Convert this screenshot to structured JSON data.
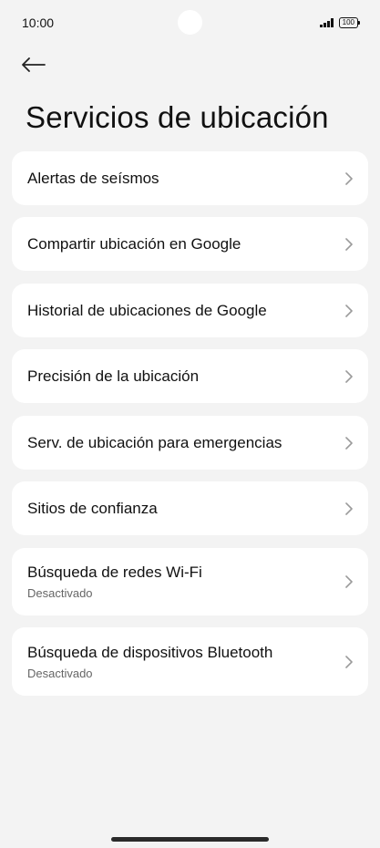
{
  "status_bar": {
    "time": "10:00",
    "battery": "100",
    "icons": [
      "signal-icon",
      "battery-icon"
    ]
  },
  "header": {
    "back_icon": "arrow-left-icon",
    "title": "Servicios de ubicación"
  },
  "items": [
    {
      "label": "Alertas de seísmos",
      "subtitle": ""
    },
    {
      "label": "Compartir ubicación en Google",
      "subtitle": ""
    },
    {
      "label": "Historial de ubicaciones de Google",
      "subtitle": ""
    },
    {
      "label": "Precisión de la ubicación",
      "subtitle": ""
    },
    {
      "label": "Serv. de ubicación para emergencias",
      "subtitle": ""
    },
    {
      "label": "Sitios de confianza",
      "subtitle": ""
    },
    {
      "label": "Búsqueda de redes Wi-Fi",
      "subtitle": "Desactivado"
    },
    {
      "label": "Búsqueda de dispositivos Bluetooth",
      "subtitle": "Desactivado"
    }
  ],
  "colors": {
    "background": "#f3f3f3",
    "card": "#ffffff",
    "text": "#111111",
    "subtext": "#666666",
    "chevron": "#9a9a9a"
  }
}
